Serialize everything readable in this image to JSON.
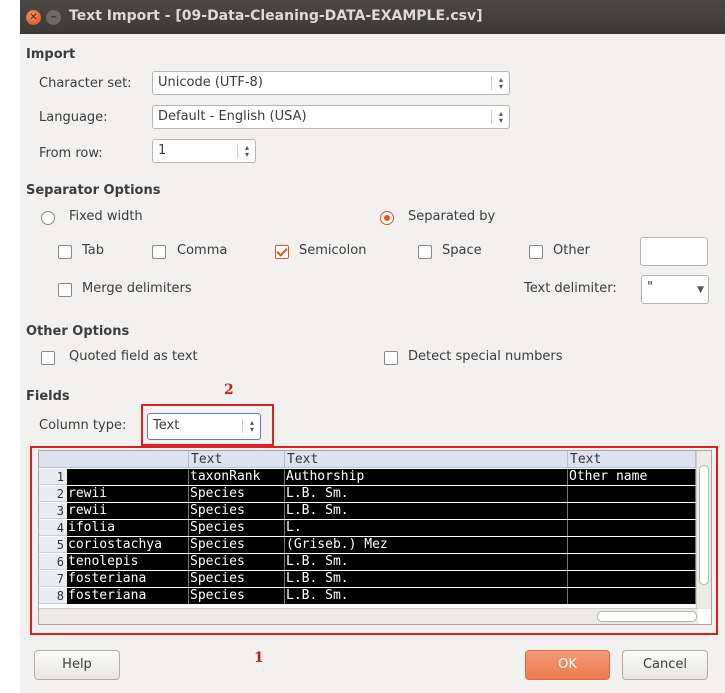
{
  "window": {
    "title": "Text Import - [09-Data-Cleaning-DATA-EXAMPLE.csv]"
  },
  "import": {
    "heading": "Import",
    "charset_label": "Character set:",
    "charset_value": "Unicode (UTF-8)",
    "language_label": "Language:",
    "language_value": "Default - English (USA)",
    "fromrow_label": "From row:",
    "fromrow_value": "1"
  },
  "separator": {
    "heading": "Separator Options",
    "fixed_width": "Fixed width",
    "separated_by": "Separated by",
    "tab": "Tab",
    "comma": "Comma",
    "semicolon": "Semicolon",
    "space": "Space",
    "other": "Other",
    "merge": "Merge delimiters",
    "text_delim_label": "Text delimiter:",
    "text_delim_value": "\""
  },
  "other_options": {
    "heading": "Other Options",
    "quoted": "Quoted field as text",
    "detect": "Detect special numbers"
  },
  "fields": {
    "heading": "Fields",
    "coltype_label": "Column type:",
    "coltype_value": "Text",
    "headers": [
      "",
      "Text",
      "Text",
      "Text"
    ],
    "rows": [
      [
        "1",
        "",
        "taxonRank",
        "Authorship",
        "Other name"
      ],
      [
        "2",
        "rewii",
        "Species",
        "L.B. Sm.",
        ""
      ],
      [
        "3",
        "rewii",
        "Species",
        "L.B. Sm.",
        ""
      ],
      [
        "4",
        "ifolia",
        "Species",
        "L.",
        ""
      ],
      [
        "5",
        "coriostachya",
        "Species",
        "(Griseb.) Mez",
        ""
      ],
      [
        "6",
        "tenolepis",
        "Species",
        "L.B. Sm.",
        ""
      ],
      [
        "7",
        "fosteriana",
        "Species",
        "L.B. Sm.",
        ""
      ],
      [
        "8",
        "fosteriana",
        "Species",
        "L.B. Sm.",
        ""
      ]
    ]
  },
  "annotations": {
    "one": "1",
    "two": "2"
  },
  "buttons": {
    "help": "Help",
    "ok": "OK",
    "cancel": "Cancel"
  },
  "colors": {
    "accent": "#e0541f",
    "annotation": "#e02020",
    "ok_button": "#ec7a4e"
  }
}
